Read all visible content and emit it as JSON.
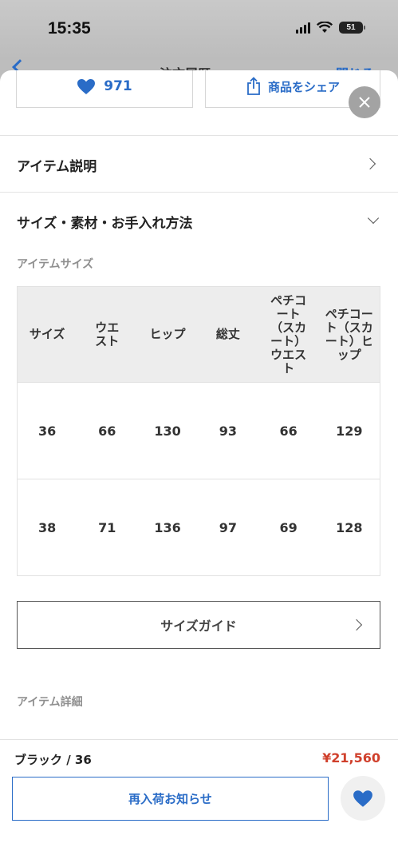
{
  "status_bar": {
    "time": "15:35",
    "battery": "51"
  },
  "nav": {
    "title": "注文履歴",
    "close_label": "閉じる"
  },
  "actions": {
    "favorite_count": "971",
    "share_label": "商品をシェア"
  },
  "sections": {
    "item_description": "アイテム説明",
    "size_material_care": "サイズ・素材・お手入れ方法",
    "item_size": "アイテムサイズ",
    "item_details": "アイテム詳細"
  },
  "size_table": {
    "headers": [
      "サイズ",
      "ウエスト",
      "ヒップ",
      "総丈",
      "ペチコート（スカート）ウエスト",
      "ペチコート（スカート）ヒップ"
    ],
    "rows": [
      [
        "36",
        "66",
        "130",
        "93",
        "66",
        "129"
      ],
      [
        "38",
        "71",
        "136",
        "97",
        "69",
        "128"
      ]
    ]
  },
  "size_guide_label": "サイズガイド",
  "footer": {
    "variant": "ブラック / 36",
    "price": "¥21,560",
    "restock_label": "再入荷お知らせ"
  },
  "colors": {
    "accent": "#2a6cc7",
    "price": "#d0402c"
  },
  "icons": [
    "heart-icon",
    "share-icon",
    "close-icon",
    "chevron-right-icon",
    "chevron-down-icon",
    "back-icon"
  ]
}
